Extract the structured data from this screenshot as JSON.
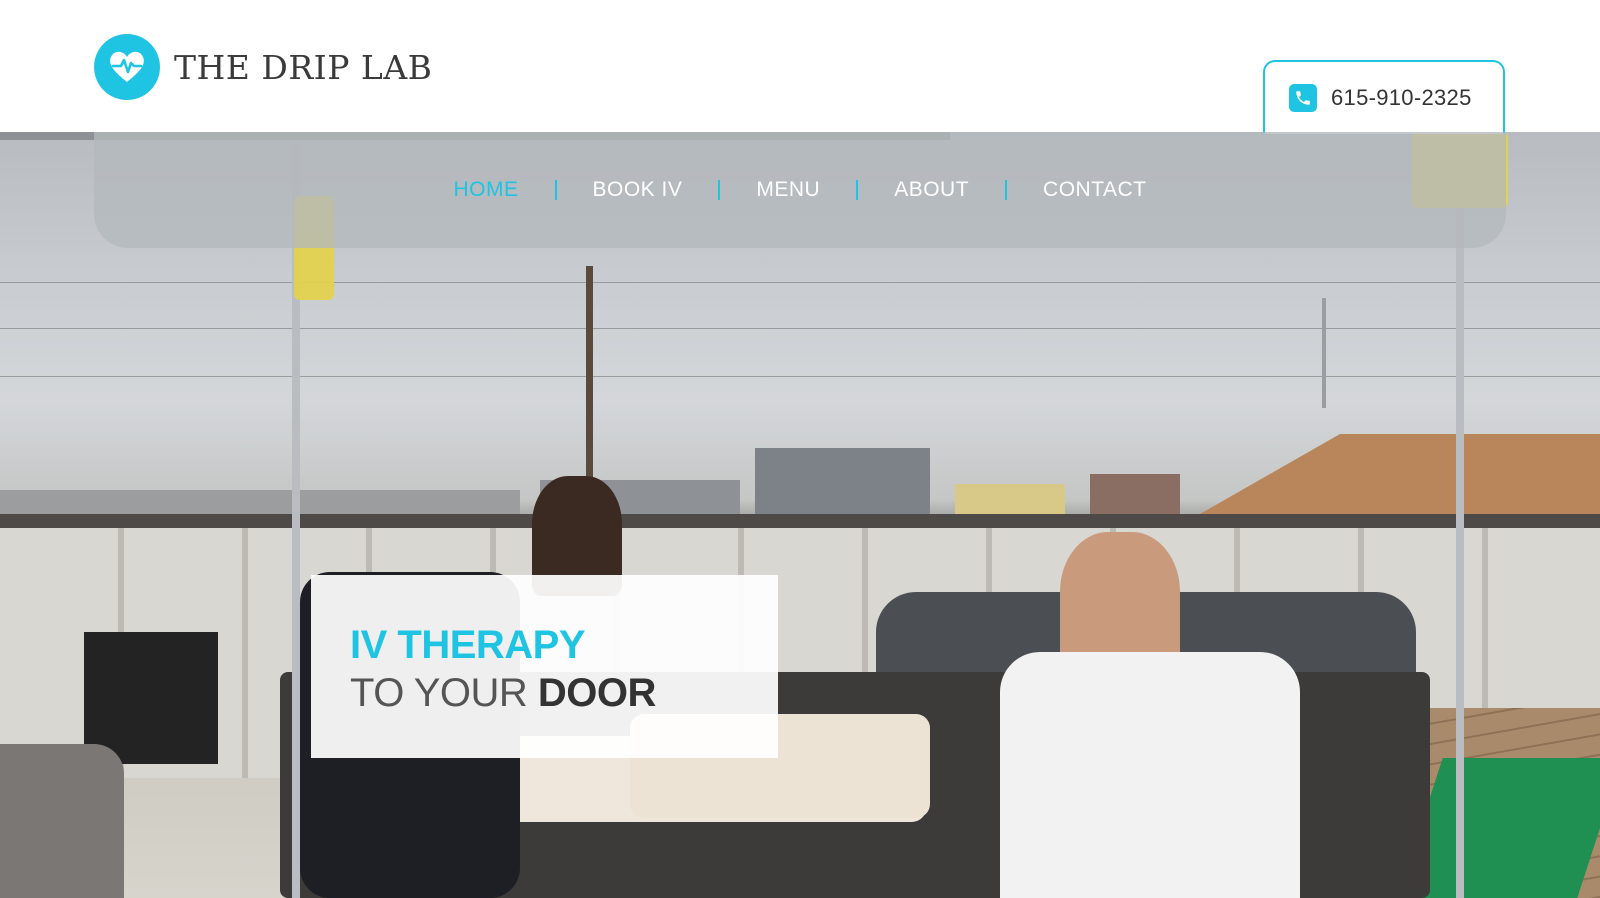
{
  "brand": {
    "name": "THE DRIP LAB",
    "logo_icon": "heart-pulse-icon",
    "accent_color": "#1fc4e3"
  },
  "contact": {
    "phone": "615-910-2325",
    "icon": "phone-icon"
  },
  "nav": {
    "items": [
      {
        "label": "HOME",
        "active": true
      },
      {
        "label": "BOOK IV",
        "active": false
      },
      {
        "label": "MENU",
        "active": false
      },
      {
        "label": "ABOUT",
        "active": false
      },
      {
        "label": "CONTACT",
        "active": false
      }
    ]
  },
  "hero": {
    "headline_accent": "IV THERAPY",
    "headline_prefix": "TO YOUR ",
    "headline_bold": "DOOR"
  }
}
